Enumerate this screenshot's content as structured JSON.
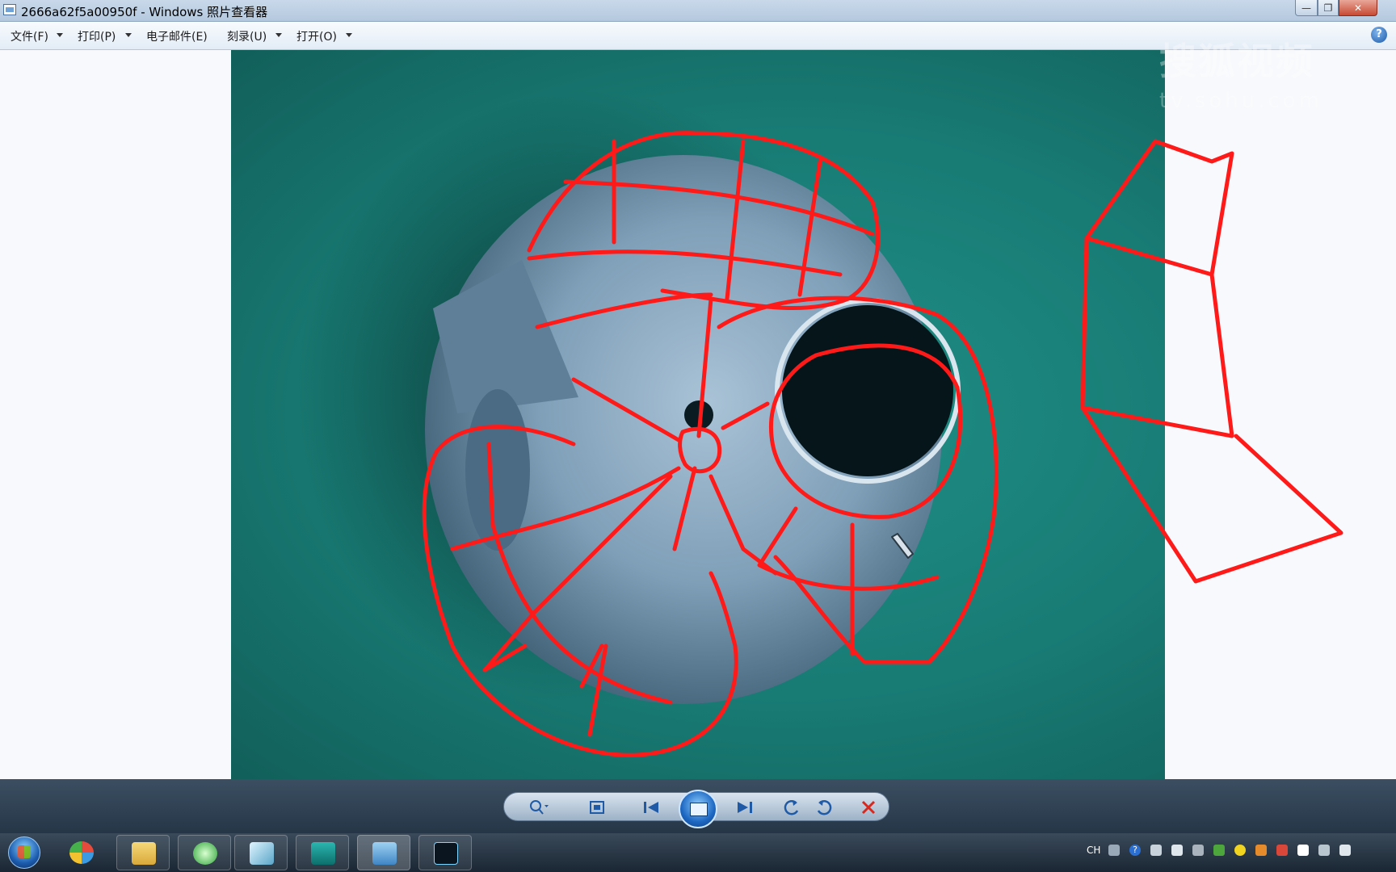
{
  "window": {
    "title": "2666a62f5a00950f - Windows 照片查看器",
    "minimize_glyph": "—",
    "maximize_glyph": "❐",
    "close_glyph": "✕"
  },
  "menu": {
    "file": "文件(F)",
    "print": "打印(P)",
    "email": "电子邮件(E)",
    "burn": "刻录(U)",
    "open": "打开(O)",
    "help_glyph": "?"
  },
  "watermark": {
    "brand": "搜狐视频",
    "url": "tv.sohu.com"
  },
  "controls": {
    "zoom_icon": "zoom-icon",
    "fit_icon": "fit-window-icon",
    "prev_icon": "previous-icon",
    "slideshow_icon": "slideshow-icon",
    "next_icon": "next-icon",
    "rotate_ccw_icon": "rotate-left-icon",
    "rotate_cw_icon": "rotate-right-icon",
    "delete_icon": "delete-icon"
  },
  "taskbar": {
    "input_method": "CH",
    "tray_help": "?"
  },
  "colors": {
    "annotation": "#ff1a1a",
    "background_teal": "#187b74",
    "accent_blue": "#1d67c2"
  }
}
